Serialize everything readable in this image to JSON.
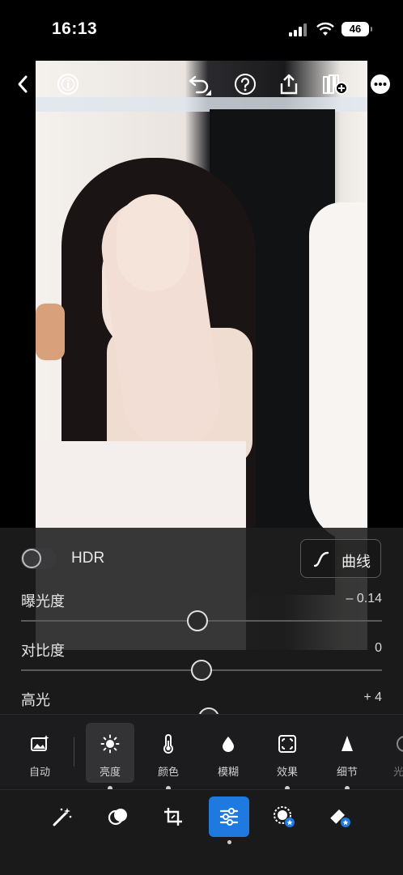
{
  "status_bar": {
    "time": "16:13",
    "battery": "46"
  },
  "adjust_panel": {
    "hdr_label": "HDR",
    "hdr_enabled": false,
    "curve_button_label": "曲线",
    "sliders": [
      {
        "name": "曝光度",
        "value": "– 0.14"
      },
      {
        "name": "对比度",
        "value": "0"
      },
      {
        "name": "高光",
        "value": "+ 4"
      }
    ]
  },
  "tools": [
    {
      "label": "自动",
      "icon": "auto-photo-icon"
    },
    {
      "label": "亮度",
      "icon": "sun-icon",
      "active": true
    },
    {
      "label": "颜色",
      "icon": "thermometer-icon"
    },
    {
      "label": "模糊",
      "icon": "drop-icon"
    },
    {
      "label": "效果",
      "icon": "effects-frame-icon"
    },
    {
      "label": "细节",
      "icon": "triangle-icon"
    },
    {
      "label": "光",
      "icon": "lens-icon"
    }
  ],
  "bottom_nav": [
    {
      "icon": "magic-wand-icon"
    },
    {
      "icon": "presets-icon"
    },
    {
      "icon": "crop-icon"
    },
    {
      "icon": "edit-sliders-icon",
      "active": true
    },
    {
      "icon": "masking-icon"
    },
    {
      "icon": "healing-eraser-icon"
    }
  ],
  "colors": {
    "accent": "#1f7ae0",
    "panel_bg": "#1e1e1e"
  }
}
